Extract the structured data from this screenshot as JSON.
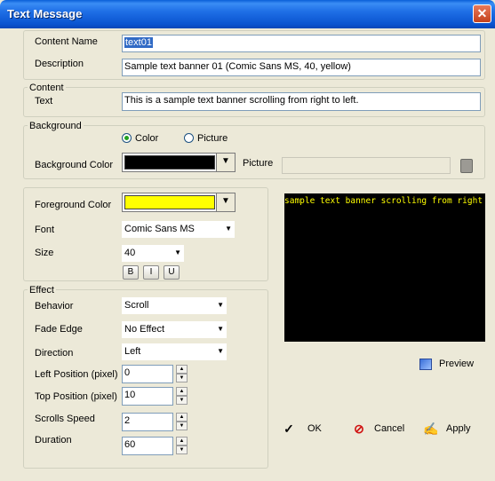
{
  "window": {
    "title": "Text Message",
    "close_glyph": "✕"
  },
  "content_name": {
    "label": "Content Name",
    "value": "text01"
  },
  "description": {
    "label": "Description",
    "value": "Sample text banner 01 (Comic Sans MS, 40, yellow)"
  },
  "content_group": {
    "legend": "Content",
    "text_label": "Text",
    "text_value": "This is a sample text banner scrolling from right to left."
  },
  "background": {
    "legend": "Background",
    "color_option": "Color",
    "picture_option": "Picture",
    "selected_option": "Color",
    "color_label": "Background Color",
    "color_value": "#000000",
    "picture_label": "Picture",
    "picture_value": ""
  },
  "foreground": {
    "color_label": "Foreground Color",
    "color_value": "#ffff00",
    "font_label": "Font",
    "font_value": "Comic Sans MS",
    "size_label": "Size",
    "size_value": "40",
    "bold": "B",
    "italic": "I",
    "underline": "U"
  },
  "effect": {
    "legend": "Effect",
    "behavior_label": "Behavior",
    "behavior_value": "Scroll",
    "fade_label": "Fade Edge",
    "fade_value": "No Effect",
    "direction_label": "Direction",
    "direction_value": "Left",
    "left_pos_label": "Left Position (pixel)",
    "left_pos_value": "0",
    "top_pos_label": "Top Position (pixel)",
    "top_pos_value": "10",
    "speed_label": "Scrolls Speed",
    "speed_value": "2",
    "duration_label": "Duration",
    "duration_value": "60"
  },
  "preview": {
    "text": "sample text banner scrolling from right to left.",
    "text_color": "#ffff00",
    "background": "#000000",
    "button_label": "Preview"
  },
  "buttons": {
    "ok": "OK",
    "cancel": "Cancel",
    "apply": "Apply"
  },
  "icons": {
    "ok": "checkmark-icon",
    "cancel": "no-entry-icon",
    "apply": "apply-icon",
    "preview": "monitor-icon",
    "folder": "folder-icon",
    "dropdown": "chevron-down-icon"
  }
}
